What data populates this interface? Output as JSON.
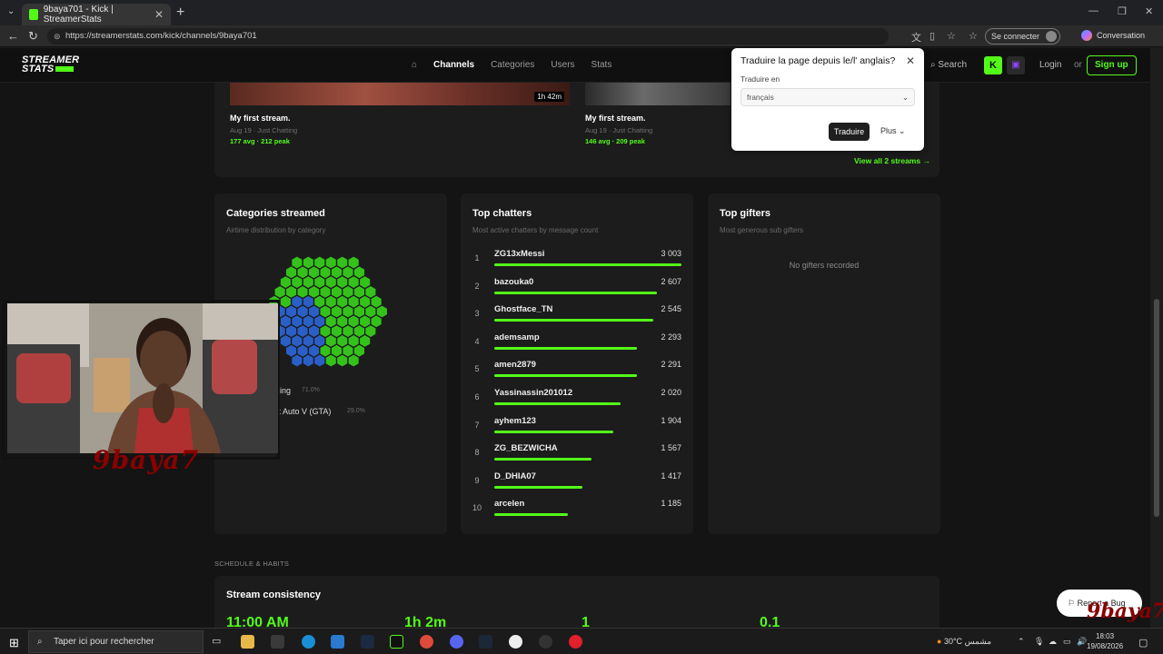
{
  "browser": {
    "tab_title": "9baya701 - Kick | StreamerStats",
    "tab_close": "✕",
    "new_tab": "+",
    "url": "https://streamerstats.com/kick/channels/9baya701",
    "profile_label": "Se connecter",
    "copilot_label": "Conversation"
  },
  "site": {
    "brand_line1": "STREAMER",
    "brand_line2": "STATS",
    "nav": [
      "Channels",
      "Categories",
      "Users",
      "Stats"
    ],
    "search_label": "Search",
    "login_label": "Login",
    "or_label": "or",
    "signup_label": "Sign up"
  },
  "streams": {
    "items": [
      {
        "title": "My first stream.",
        "meta": "Aug 19 · Just Chatting",
        "stats": "177 avg · 212 peak",
        "duration": "1h 42m"
      },
      {
        "title": "My first stream.",
        "meta": "Aug 19 · Just Chatting",
        "stats": "146 avg · 209 peak"
      }
    ],
    "view_all": "View all 2 streams →"
  },
  "translate_popup": {
    "question": "Traduire la page depuis le/l' anglais?",
    "target_label": "Traduire en",
    "target_value": "français",
    "translate_button": "Traduire",
    "more_button": "Plus"
  },
  "categories": {
    "title": "Categories streamed",
    "subtitle": "Airtime distribution by category",
    "items": [
      {
        "name": "ing",
        "pct": "71.0%",
        "color": "#34c21a"
      },
      {
        "name": "ft Auto V (GTA)",
        "pct": "29.0%",
        "color": "#2a5fc7"
      }
    ]
  },
  "chatters": {
    "title": "Top chatters",
    "subtitle": "Most active chatters by message count",
    "items": [
      {
        "rank": "1",
        "name": "ZG13xMessi",
        "count": "3 003",
        "value": 3003
      },
      {
        "rank": "2",
        "name": "bazouka0",
        "count": "2 607",
        "value": 2607
      },
      {
        "rank": "3",
        "name": "Ghostface_TN",
        "count": "2 545",
        "value": 2545
      },
      {
        "rank": "4",
        "name": "ademsamp",
        "count": "2 293",
        "value": 2293
      },
      {
        "rank": "5",
        "name": "amen2879",
        "count": "2 291",
        "value": 2291
      },
      {
        "rank": "6",
        "name": "Yassinassin201012",
        "count": "2 020",
        "value": 2020
      },
      {
        "rank": "7",
        "name": "ayhem123",
        "count": "1 904",
        "value": 1904
      },
      {
        "rank": "8",
        "name": "ZG_BEZWICHA",
        "count": "1 567",
        "value": 1567
      },
      {
        "rank": "9",
        "name": "D_DHIA07",
        "count": "1 417",
        "value": 1417
      },
      {
        "rank": "10",
        "name": "arcelen",
        "count": "1 185",
        "value": 1185
      }
    ]
  },
  "gifters": {
    "title": "Top gifters",
    "subtitle": "Most generous sub gifters",
    "empty": "No gifters recorded"
  },
  "schedule": {
    "section_label": "SCHEDULE & HABITS",
    "title": "Stream consistency",
    "stats": [
      "11:00 AM",
      "1h 2m",
      "1",
      "0.1"
    ]
  },
  "overlay": {
    "report_bug": "Report a Bug",
    "logo": "9baya7"
  },
  "taskbar": {
    "search_placeholder": "Taper ici pour rechercher",
    "weather": "30°C  مشمس",
    "time": "18:03",
    "date": "19/08/2026"
  },
  "colors": {
    "accent": "#53fc18",
    "background": "#141414",
    "card": "#1c1c1c"
  }
}
